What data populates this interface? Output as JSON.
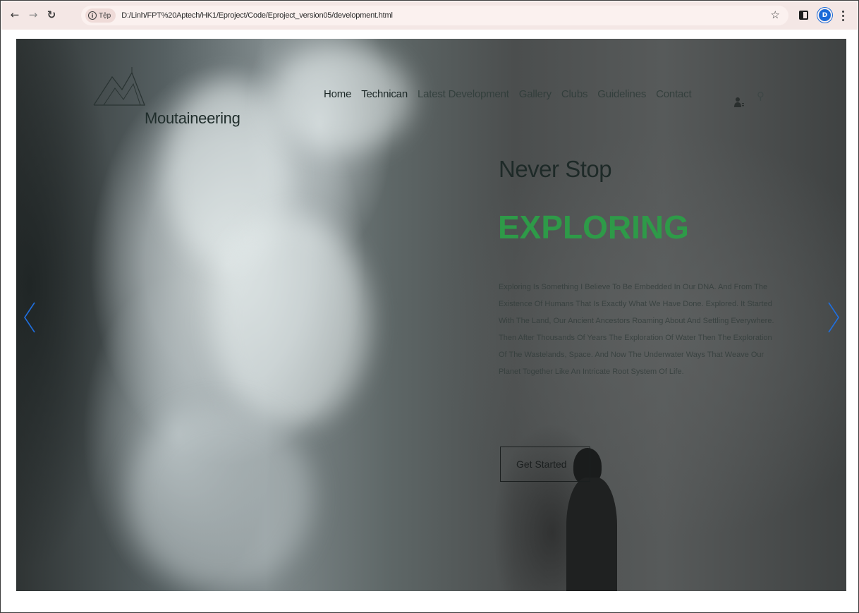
{
  "browser": {
    "site_info_label": "Tệp",
    "url": "D:/Linh/FPT%20Aptech/HK1/Eproject/Code/Eproject_version05/development.html",
    "profile_initial": "D",
    "icons": {
      "back": "arrow-left",
      "forward": "arrow-right",
      "reload": "reload",
      "site_info": "info",
      "bookmark": "star",
      "side_panel": "side-panel",
      "menu": "three-dots-vertical"
    }
  },
  "header": {
    "brand_name": "Moutaineering",
    "nav_items": [
      {
        "label": "Home"
      },
      {
        "label": "Technican"
      },
      {
        "label": "Latest Development"
      },
      {
        "label": "Gallery"
      },
      {
        "label": "Clubs"
      },
      {
        "label": "Guidelines"
      },
      {
        "label": "Contact"
      }
    ],
    "icons": {
      "user": "user-icon",
      "search": "search-icon"
    }
  },
  "hero": {
    "headline": "Never Stop",
    "subheadline": "EXPLORING",
    "body": "Exploring Is Something I Believe To Be Embedded In Our DNA. And From The Existence Of Humans That Is Exactly What We Have Done. Explored. It Started With The Land, Our Ancient Ancestors Roaming About And Settling Everywhere. Then After Thousands Of Years The Exploration Of Water Then The Exploration Of The Wastelands, Space. And Now The Underwater Ways That Weave Our Planet Together Like An Intricate Root System Of Life.",
    "cta_label": "Get Started"
  },
  "colors": {
    "accent_green": "#2e9a48",
    "slider_arrow": "#1f6fe0",
    "chrome_bg": "#f4e7e5"
  }
}
